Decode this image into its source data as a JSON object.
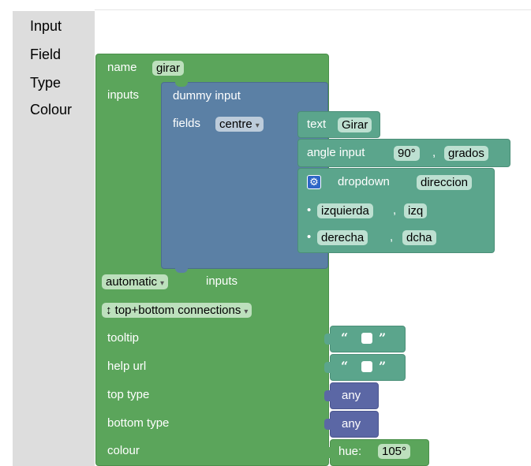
{
  "toolbox": {
    "categories": [
      {
        "label": "Input"
      },
      {
        "label": "Field"
      },
      {
        "label": "Type"
      },
      {
        "label": "Colour"
      }
    ]
  },
  "factory_base": {
    "name_label": "name",
    "name_value": "girar",
    "inputs_label": "inputs",
    "inputs_mode_value": "automatic",
    "inputs_mode_suffix": "inputs",
    "connections_value": "↕ top+bottom connections",
    "tooltip_label": "tooltip",
    "help_url_label": "help url",
    "top_type_label": "top type",
    "bottom_type_label": "bottom type",
    "colour_label": "colour"
  },
  "input_block": {
    "title": "dummy input",
    "fields_label": "fields",
    "align_value": "centre"
  },
  "field_text": {
    "label": "text",
    "value": "Girar"
  },
  "field_angle": {
    "label": "angle input",
    "angle_value": "90°",
    "separator": ",",
    "name_value": "grados"
  },
  "field_dropdown": {
    "label": "dropdown",
    "name_value": "direccion",
    "options": [
      {
        "bullet": "•",
        "text": "izquierda",
        "separator": ",",
        "value": "izq"
      },
      {
        "bullet": "•",
        "text": "derecha",
        "separator": ",",
        "value": "dcha"
      }
    ]
  },
  "value_blocks": {
    "open_quote": "“",
    "close_quote": "”",
    "top_type": "any",
    "bottom_type": "any",
    "hue_label": "hue:",
    "hue_value": "105°"
  },
  "icons": {
    "gear": "gear-icon",
    "dropdown_arrow": "▾"
  },
  "colors": {
    "factory_base": "#5ba55b",
    "input": "#5b80a5",
    "field": "#5ba58c",
    "type": "#5b67a5",
    "toolbox": "#dddddd"
  }
}
